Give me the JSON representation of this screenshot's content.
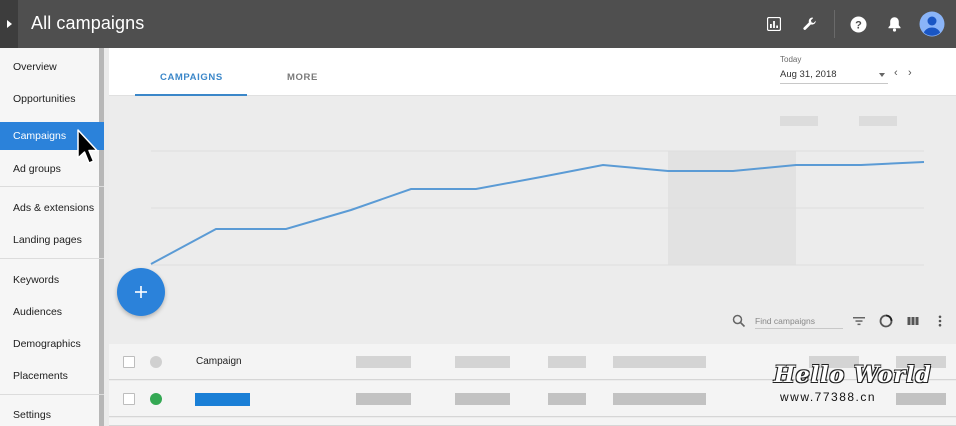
{
  "header": {
    "title": "All campaigns",
    "icons": [
      "expand-menu-icon",
      "reports-icon",
      "tools-wrench-icon",
      "help-icon",
      "notifications-icon",
      "account-avatar-icon"
    ]
  },
  "sidebar": {
    "items": [
      {
        "label": "Overview",
        "active": false
      },
      {
        "label": "Opportunities",
        "active": false
      },
      {
        "label": "Campaigns",
        "active": true
      },
      {
        "label": "Ad groups",
        "active": false
      },
      {
        "label": "Ads & extensions",
        "active": false
      },
      {
        "label": "Landing pages",
        "active": false
      },
      {
        "label": "Keywords",
        "active": false
      },
      {
        "label": "Audiences",
        "active": false
      },
      {
        "label": "Demographics",
        "active": false
      },
      {
        "label": "Placements",
        "active": false
      },
      {
        "label": "Settings",
        "active": false
      }
    ]
  },
  "tabs": [
    {
      "label": "CAMPAIGNS",
      "active": true
    },
    {
      "label": "MORE",
      "active": false
    }
  ],
  "date": {
    "label": "Today",
    "value": "Aug 31, 2018",
    "prev": "‹",
    "next": "›"
  },
  "table": {
    "search_placeholder": "Find campaigns",
    "header": {
      "campaign": "Campaign"
    },
    "status_color": "#34a853"
  },
  "colors": {
    "accent": "#2b82da",
    "topbar": "#4f4f4f",
    "line": "#5b9bd5",
    "avatar": "#8ab4f8"
  },
  "watermark": {
    "title": "Hello World",
    "url": "www.77388.cn"
  }
}
